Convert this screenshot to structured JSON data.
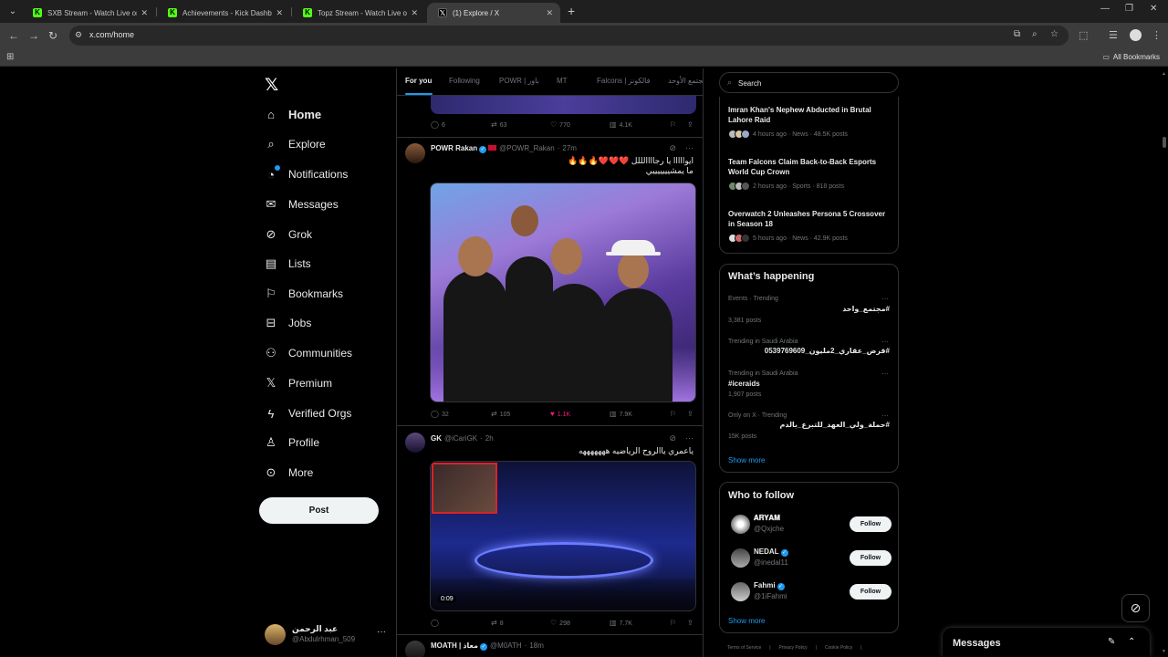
{
  "browser": {
    "tabs": [
      {
        "title": "SXB Stream - Watch Live on Kick",
        "favicon": "kick-icon",
        "active": false
      },
      {
        "title": "Achievements - Kick Dashboard",
        "favicon": "kick-icon",
        "active": false
      },
      {
        "title": "Topz Stream - Watch Live on Kick",
        "favicon": "kick-icon",
        "active": false
      },
      {
        "title": "(1) Explore / X",
        "favicon": "x-icon",
        "active": true
      }
    ],
    "new_tab": "+",
    "url": "x.com/home",
    "all_bookmarks": "All Bookmarks"
  },
  "nav": {
    "items": [
      {
        "label": "Home",
        "icon": "home-icon"
      },
      {
        "label": "Explore",
        "icon": "search-icon"
      },
      {
        "label": "Notifications",
        "icon": "bell-icon"
      },
      {
        "label": "Messages",
        "icon": "envelope-icon"
      },
      {
        "label": "Grok",
        "icon": "grok-icon"
      },
      {
        "label": "Lists",
        "icon": "list-icon"
      },
      {
        "label": "Bookmarks",
        "icon": "bookmark-icon"
      },
      {
        "label": "Jobs",
        "icon": "briefcase-icon"
      },
      {
        "label": "Communities",
        "icon": "people-icon"
      },
      {
        "label": "Premium",
        "icon": "x-icon"
      },
      {
        "label": "Verified Orgs",
        "icon": "lightning-icon"
      },
      {
        "label": "Profile",
        "icon": "person-icon"
      },
      {
        "label": "More",
        "icon": "more-circle-icon"
      }
    ],
    "post_label": "Post",
    "account": {
      "name": "عبد الرحمن",
      "handle": "@Abdulrhman_509"
    }
  },
  "feed": {
    "tabs": [
      "For you",
      "Following",
      "POWR | باور",
      "MT",
      "Falcons | فالكونز",
      "مجتمع الأوحد"
    ],
    "top_actions": {
      "replies": "6",
      "reposts": "63",
      "likes": "770",
      "views": "4.1K"
    },
    "tweets": [
      {
        "name": "POWR Rakan",
        "handle": "@POWR_Rakan",
        "time": "27m",
        "text": "ايوااااا يا رجاااالللل ❤️❤️❤️🔥🔥🔥",
        "text2": "ما يمشيييييييي",
        "replies": "32",
        "reposts": "105",
        "likes": "1.1K",
        "views": "7.9K"
      },
      {
        "name": "GK",
        "handle": "@iCariGK",
        "time": "2h",
        "text": "ياعمري ياالروح الرياضيه هههههههه",
        "video_time": "0:09",
        "replies": "",
        "reposts": "8",
        "likes": "298",
        "views": "7.7K"
      },
      {
        "name": "MOATH | معاذ",
        "handle": "@M0ATH",
        "time": "18m"
      }
    ]
  },
  "sidebar": {
    "search_placeholder": "Search",
    "news": [
      {
        "title": "Imran Khan's Nephew Abducted in Brutal Lahore Raid",
        "meta": "4 hours ago · News · 48.5K posts"
      },
      {
        "title": "Team Falcons Claim Back-to-Back Esports World Cup Crown",
        "meta": "2 hours ago · Sports · 818 posts"
      },
      {
        "title": "Overwatch 2 Unleashes Persona 5 Crossover in Season 18",
        "meta": "5 hours ago · News · 42.9K posts"
      }
    ],
    "whats_happening": {
      "title": "What’s happening",
      "trends": [
        {
          "context": "Events · Trending",
          "name": "#مجتمع_واحد",
          "count": "3,381 posts",
          "rtl": true
        },
        {
          "context": "Trending in Saudi Arabia",
          "name": "#قرض_عقاري_2مليون_0539769609",
          "count": "",
          "rtl": true
        },
        {
          "context": "Trending in Saudi Arabia",
          "name": "#iceraids",
          "count": "1,907 posts",
          "rtl": false
        },
        {
          "context": "Only on X · Trending",
          "name": "#حملة_ولي_العهد_للتبرع_بالدم",
          "count": "15K posts",
          "rtl": true
        }
      ],
      "show_more": "Show more"
    },
    "who_to_follow": {
      "title": "Who to follow",
      "users": [
        {
          "name": "𝐀𝐑𝐘𝐀𝐌",
          "handle": "@Qxjche",
          "verified": false
        },
        {
          "name": "NEDAL",
          "handle": "@inedal11",
          "verified": true
        },
        {
          "name": "Fahmi",
          "handle": "@1iFahmi",
          "verified": true
        }
      ],
      "follow_label": "Follow",
      "show_more": "Show more"
    },
    "footer": [
      "Terms of Service",
      "|",
      "Privacy Policy",
      "|",
      "Cookie Policy",
      "|"
    ]
  },
  "dm": {
    "title": "Messages"
  },
  "colors": {
    "accent": "#1d9bf0",
    "like": "#f91880",
    "background": "#000000",
    "border": "#2f3336"
  }
}
